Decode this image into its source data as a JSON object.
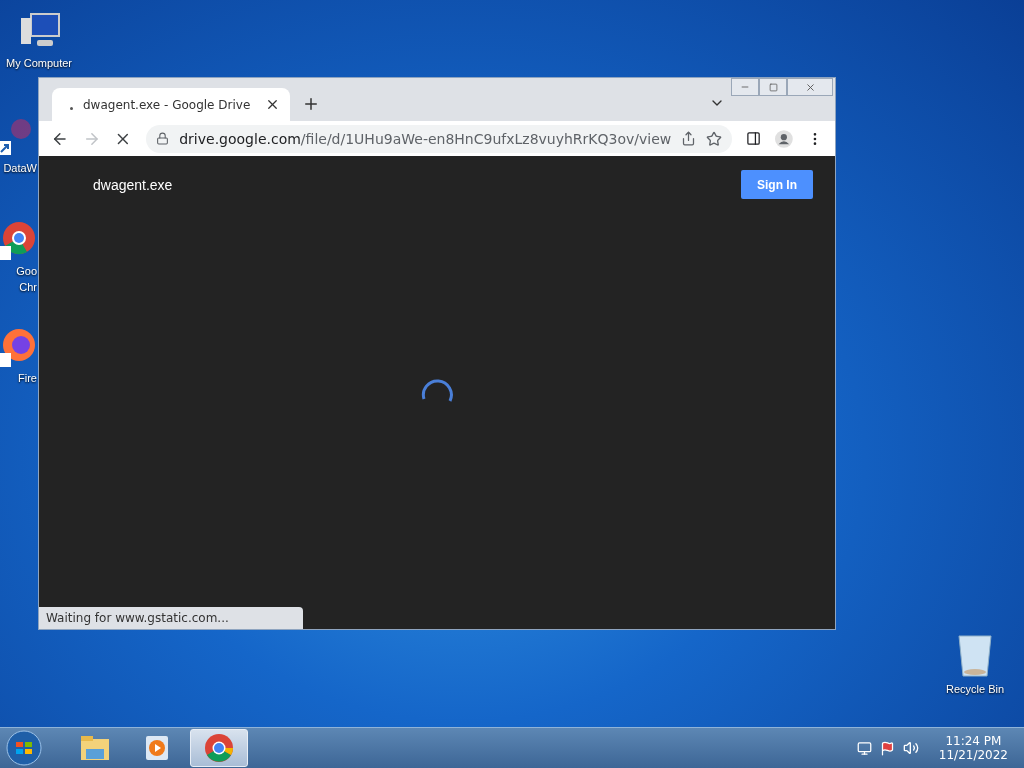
{
  "desktop_icons": [
    {
      "kind": "computer",
      "label_lines": [
        "My Computer"
      ]
    },
    {
      "kind": "shortcut",
      "label_lines": [
        "DataW"
      ]
    },
    {
      "kind": "chrome",
      "label_lines": [
        "Goo",
        "Chr"
      ]
    },
    {
      "kind": "firefox",
      "label_lines": [
        "Fire"
      ]
    },
    {
      "kind": "recycle",
      "label_lines": [
        "Recycle Bin"
      ]
    }
  ],
  "browser": {
    "tabs": [
      {
        "title": "dwagent.exe - Google Drive",
        "selected": true
      }
    ],
    "url_host": "drive.google.com",
    "url_path": "/file/d/1UHu9aWe-en8HnC9ufxLz8vuyhRrKQ3ov/view",
    "loading": true,
    "page": {
      "file_name": "dwagent.exe",
      "sign_in": "Sign In"
    },
    "status": "Waiting for www.gstatic.com..."
  },
  "taskbar": {
    "apps": [
      {
        "kind": "explorer",
        "active": false
      },
      {
        "kind": "media",
        "active": false
      },
      {
        "kind": "chrome",
        "active": true
      }
    ],
    "time": "11:24 PM",
    "date": "11/21/2022"
  }
}
